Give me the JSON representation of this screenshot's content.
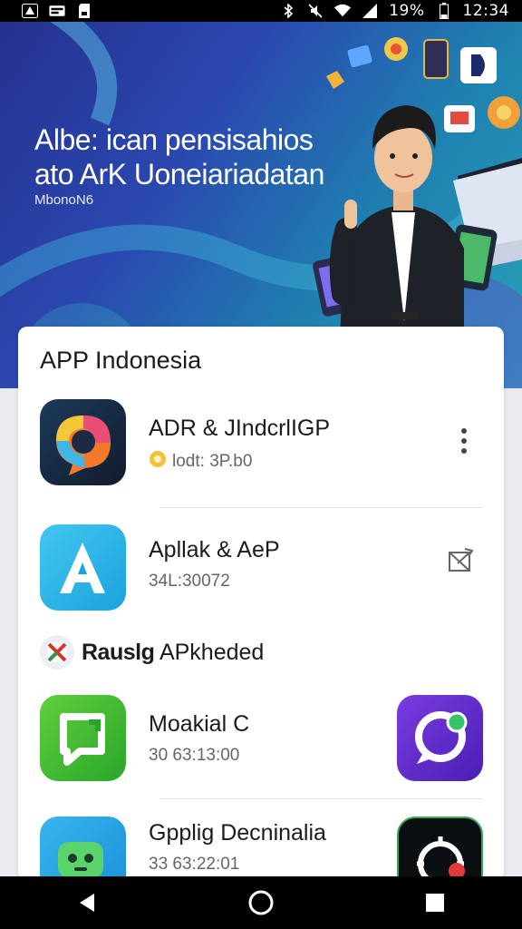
{
  "status_bar": {
    "battery_percent": "19%",
    "time": "12:34"
  },
  "hero": {
    "title_line1": "Albe: ican pensisahios",
    "title_line2": "ato ArK Uoneiariadatan",
    "subtitle": "MbonoN6"
  },
  "card": {
    "title": "APP Indonesia",
    "apps": [
      {
        "name": "ADR & JIndcrlIGP",
        "meta": "lodt: 3P.b0",
        "icon": "multicolor-chat-icon"
      },
      {
        "name": "Apllak & AeP",
        "meta": "34L:30072",
        "icon": "letter-a-icon"
      }
    ],
    "section": {
      "label_bold": "Rauslg",
      "label_rest": "APkheded"
    },
    "section_apps": [
      {
        "name": "Moakial C",
        "meta": "30 63:13:00",
        "icon": "green-chat-icon"
      },
      {
        "name": "Gpplig Decninalia",
        "meta": "33 63:22:01",
        "icon": "robot-icon"
      }
    ]
  },
  "colors": {
    "hero_start": "#26318f",
    "hero_end": "#2aa3b8",
    "card_bg": "#ffffff",
    "nav_bg": "#000000"
  }
}
